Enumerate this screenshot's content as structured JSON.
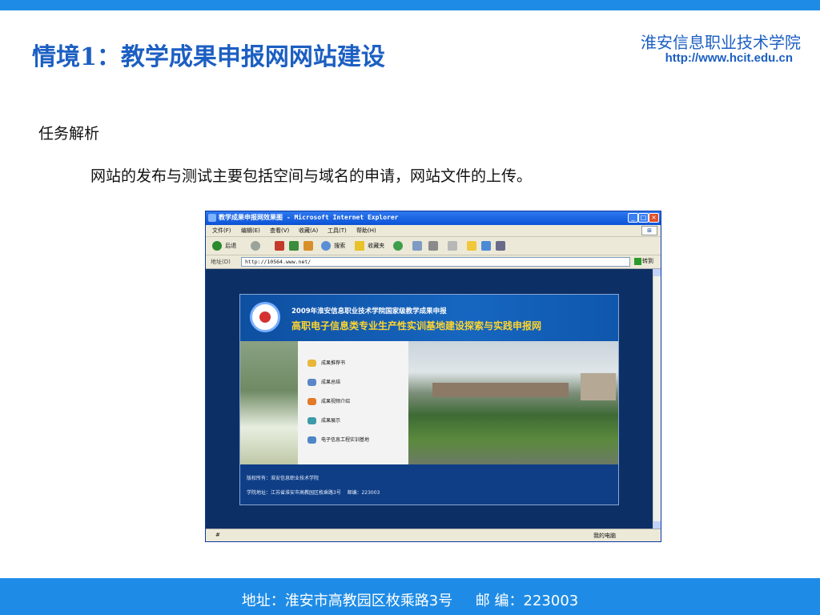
{
  "slide": {
    "title": "情境1：教学成果申报网网站建设",
    "school_name": "淮安信息职业技术学院",
    "school_url": "http://www.hcit.edu.cn",
    "task_heading": "任务解析",
    "task_body": "网站的发布与测试主要包括空间与域名的申请，网站文件的上传。",
    "footer": "地址：淮安市高教园区枚乘路3号     邮 编：223003"
  },
  "browser": {
    "title": "教学成果申报网效果图 - Microsoft Internet Explorer",
    "menu": [
      "文件(F)",
      "编辑(E)",
      "查看(V)",
      "收藏(A)",
      "工具(T)",
      "帮助(H)"
    ],
    "toolbar": {
      "back": "后退",
      "search": "搜索",
      "favorites": "收藏夹"
    },
    "address_label": "地址(D)",
    "address_value": "http://10564.www.net/",
    "go_label": "转到",
    "status_left": "#",
    "status_right": "我的电脑"
  },
  "site": {
    "header_line1": "2009年淮安信息职业技术学院国家级教学成果申报",
    "header_line2": "高职电子信息类专业生产性实训基地建设探索与实践申报网",
    "menu_items": [
      "成果推荐书",
      "成果总结",
      "成果视频介绍",
      "成果展示",
      "电子信息工程实训基地"
    ],
    "footer_copyright": "版权所有：淮安信息职业技术学院",
    "footer_address": "学院地址：江苏省淮安市高教园区枚乘路3号",
    "footer_postcode": "邮编：223003"
  },
  "colors": {
    "accent": "#1e8ce6",
    "title": "#1c5fc2"
  }
}
